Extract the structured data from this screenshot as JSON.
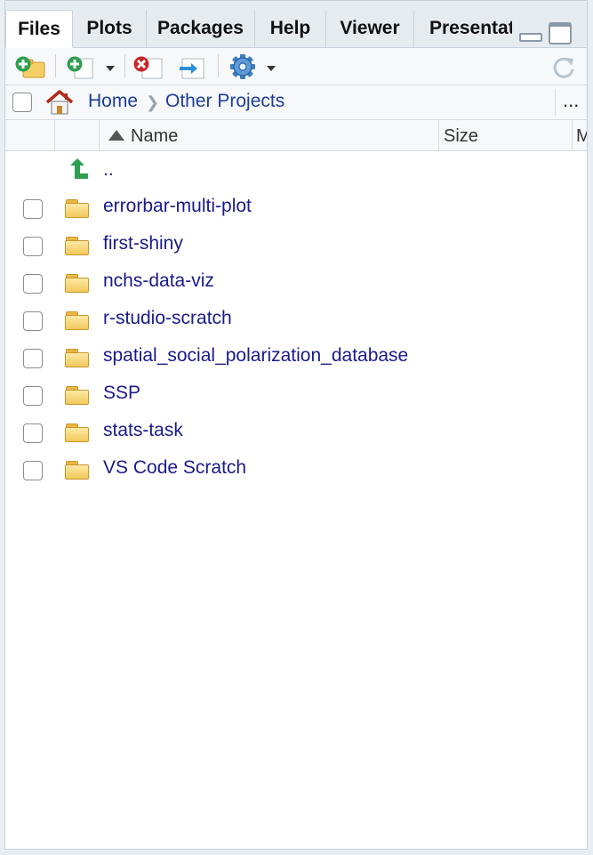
{
  "tabs": [
    {
      "label": "Files",
      "active": true
    },
    {
      "label": "Plots",
      "active": false
    },
    {
      "label": "Packages",
      "active": false
    },
    {
      "label": "Help",
      "active": false
    },
    {
      "label": "Viewer",
      "active": false
    },
    {
      "label": "Presentat",
      "active": false
    }
  ],
  "toolbar": {
    "icons": [
      "new-folder-icon",
      "new-blank-file-icon",
      "delete-icon",
      "rename-icon",
      "gear-icon",
      "refresh-icon"
    ]
  },
  "breadcrumb": {
    "home_label": "Home",
    "current_label": "Other Projects",
    "more_label": "..."
  },
  "columns": {
    "name": "Name",
    "size": "Size",
    "modified": "M"
  },
  "parent_dir_label": "..",
  "files": [
    {
      "name": "errorbar-multi-plot",
      "type": "folder"
    },
    {
      "name": "first-shiny",
      "type": "folder"
    },
    {
      "name": "nchs-data-viz",
      "type": "folder"
    },
    {
      "name": "r-studio-scratch",
      "type": "folder"
    },
    {
      "name": "spatial_social_polarization_database",
      "type": "folder"
    },
    {
      "name": "SSP",
      "type": "folder"
    },
    {
      "name": "stats-task",
      "type": "folder"
    },
    {
      "name": "VS Code Scratch",
      "type": "folder"
    }
  ],
  "colors": {
    "link": "#1a1a8c",
    "crumb": "#1f3d99",
    "folder": "#f2c85b",
    "up_arrow": "#2e9e4f"
  }
}
